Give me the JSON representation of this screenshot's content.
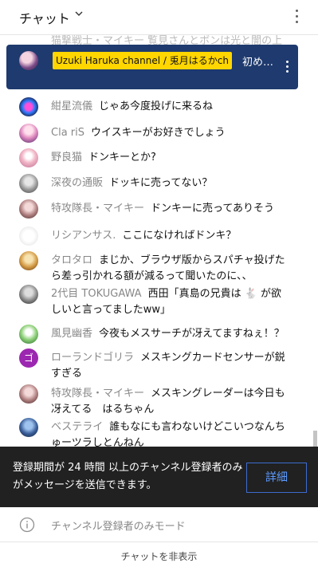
{
  "header": {
    "title": "チャット"
  },
  "ghost": {
    "text": "猫撃戦士・マイキー 覧見さんとボンは光と闇の上"
  },
  "pinned": {
    "channel": "Uzuki Haruka channel / 兎月はるかch",
    "text": "初め…"
  },
  "messages": [
    {
      "author": "紺星流儀",
      "text": "じゃあ今度投げに来るね"
    },
    {
      "author": "Cla riS",
      "text": "ウイスキーがお好きでしょう"
    },
    {
      "author": "野良猫",
      "text": "ドンキーとか?"
    },
    {
      "author": "深夜の通販",
      "text": "ドッキに売ってない？"
    },
    {
      "author": "特攻隊長・マイキー",
      "text": "ドンキーに売ってありそう"
    },
    {
      "author": "リシアンサス.",
      "text": "ここになければドンキ？"
    },
    {
      "author": "タロタロ",
      "text": "まじか、ブラウザ版からスパチャ投げたら差っ引かれる額が減るって聞いたのに、、"
    },
    {
      "author": "2代目 TOKUGAWA",
      "text": "西田「真島の兄貴は 🐇 が欲しいと言ってましたww」"
    },
    {
      "author": "風見幽香",
      "text": "今夜もメスサーチが冴えてますねぇ！？"
    },
    {
      "author": "ローランドゴリラ",
      "text": "メスキングカードセンサーが鋭すぎる",
      "initial": "ゴ"
    },
    {
      "author": "特攻隊長・マイキー",
      "text": "メスキングレーダーは今日も冴えてる　はるちゃん"
    },
    {
      "author": "ベステライ",
      "text": "誰もなにも言わないけどこいつなんちゅーツラしとんねん"
    }
  ],
  "banner": {
    "text": "登録期間が 24 時間 以上のチャンネル登録者のみがメッセージを送信できます。",
    "button": "詳細"
  },
  "mode": {
    "label": "チャンネル登録者のみモード"
  },
  "footer": {
    "hide_chat": "チャットを非表示"
  },
  "colors": {
    "pinned_bg": "#1e3a6e",
    "chip_bg": "#ffd600",
    "banner_bg": "#212121",
    "link_blue": "#5d9bff",
    "avatar_purple": "#9c27b0"
  }
}
